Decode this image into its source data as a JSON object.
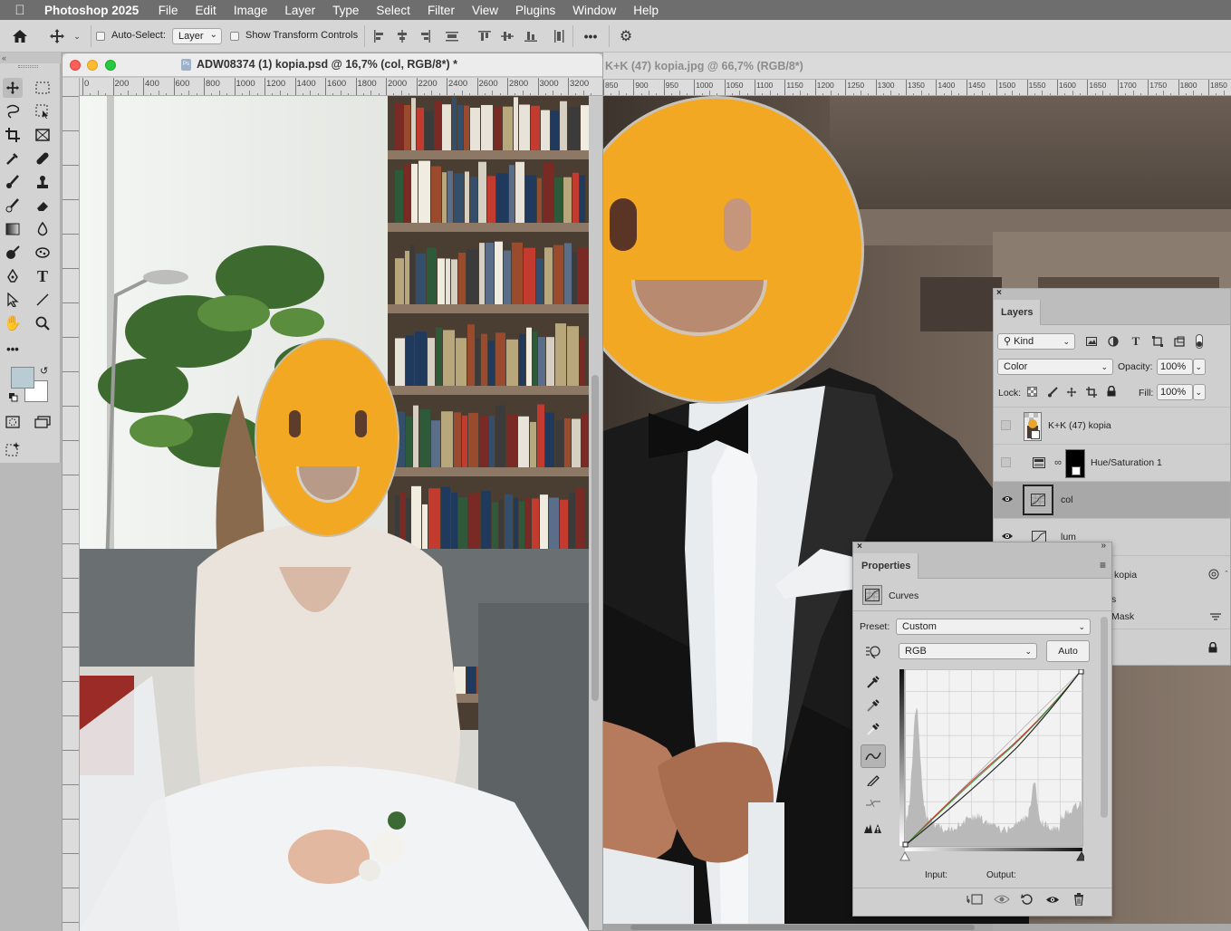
{
  "menubar": {
    "app": "Photoshop 2025",
    "items": [
      "File",
      "Edit",
      "Image",
      "Layer",
      "Type",
      "Select",
      "Filter",
      "View",
      "Plugins",
      "Window",
      "Help"
    ]
  },
  "options": {
    "auto_select_label": "Auto-Select:",
    "auto_select_value": "Layer",
    "transform_label": "Show Transform Controls"
  },
  "doc1": {
    "title": "ADW08374 (1) kopia.psd @ 16,7% (col, RGB/8*) *",
    "ruler_ticks": [
      "0",
      "200",
      "400",
      "600",
      "800",
      "1000",
      "1200",
      "1400",
      "1600",
      "1800",
      "2000",
      "2200",
      "2400",
      "2600",
      "2800",
      "3000",
      "3200"
    ]
  },
  "doc2": {
    "title": "K+K (47) kopia.jpg @ 66,7% (RGB/8*)",
    "ruler_ticks": [
      "850",
      "900",
      "950",
      "1000",
      "1050",
      "1100",
      "1150",
      "1200",
      "1250",
      "1300",
      "1350",
      "1400",
      "1450",
      "1500",
      "1550",
      "1600",
      "1650",
      "1700",
      "1750",
      "1800",
      "1850"
    ]
  },
  "layers": {
    "tab": "Layers",
    "filter_kind": "Kind",
    "blend_mode": "Color",
    "opacity_label": "Opacity:",
    "opacity": "100%",
    "lock_label": "Lock:",
    "fill_label": "Fill:",
    "fill": "100%",
    "items": [
      {
        "name": "K+K (47) kopia",
        "visible": false
      },
      {
        "name": "Hue/Saturation 1",
        "visible": false
      },
      {
        "name": "col",
        "visible": true,
        "selected": true
      },
      {
        "name": "lum",
        "visible": true
      }
    ],
    "partial_labels": [
      "kopia",
      "s",
      "Mask"
    ]
  },
  "properties": {
    "tab": "Properties",
    "type_label": "Curves",
    "preset_label": "Preset:",
    "preset_value": "Custom",
    "channel_value": "RGB",
    "auto_label": "Auto",
    "input_label": "Input:",
    "output_label": "Output:"
  },
  "colors": {
    "smiley": "#f3a823",
    "foreground_swatch": "#b9cbd3",
    "background_swatch": "#ffffff",
    "accent_curve_red": "#d12a2a",
    "accent_curve_green": "#2c9a3a"
  }
}
